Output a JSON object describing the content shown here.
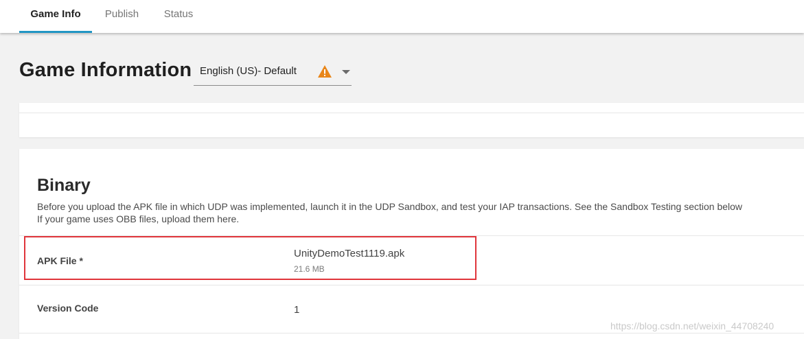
{
  "tabs": [
    {
      "label": "Game Info",
      "active": true
    },
    {
      "label": "Publish",
      "active": false
    },
    {
      "label": "Status",
      "active": false
    }
  ],
  "page_title": "Game Information",
  "language_select": {
    "value": "English (US)- Default",
    "warning_icon": "warning-triangle-icon",
    "warning_color": "#e8861a",
    "dropdown_icon": "chevron-down-icon"
  },
  "binary": {
    "title": "Binary",
    "description_line1": "Before you upload the APK file in which UDP was implemented, launch it in the UDP Sandbox, and test your IAP transactions. See the Sandbox Testing section below",
    "description_line2": "If your game uses OBB files, upload them here.",
    "apk": {
      "label": "APK File *",
      "file_name": "UnityDemoTest1119.apk",
      "file_size": "21.6 MB"
    },
    "version_code": {
      "label": "Version Code",
      "value": "1"
    }
  },
  "colors": {
    "accent": "#2196c4",
    "highlight": "#e0343a"
  },
  "watermark": "https://blog.csdn.net/weixin_44708240"
}
